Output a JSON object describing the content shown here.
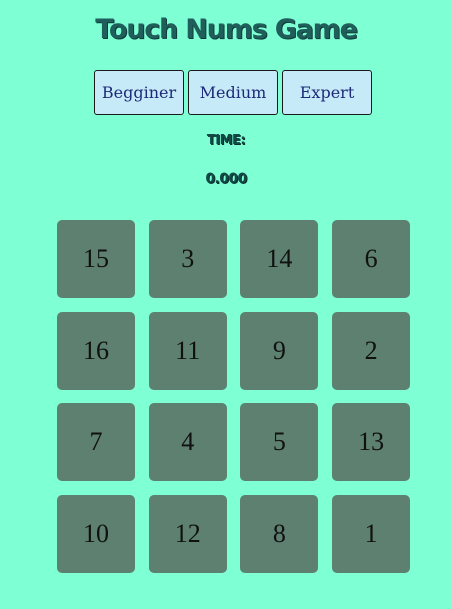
{
  "header": {
    "title": "Touch Nums Game"
  },
  "levels": [
    {
      "label": "Begginer"
    },
    {
      "label": "Medium"
    },
    {
      "label": "Expert"
    }
  ],
  "timer": {
    "label": "TIME:",
    "value": "0.000"
  },
  "board": {
    "tiles": [
      15,
      3,
      14,
      6,
      16,
      11,
      9,
      2,
      7,
      4,
      5,
      13,
      10,
      12,
      8,
      1
    ]
  },
  "colors": {
    "background": "#7fffd4",
    "title": "#1f5e5a",
    "button_bg": "#c6eaf8",
    "button_text": "#1e2a78",
    "tile_bg": "#5d8070"
  }
}
